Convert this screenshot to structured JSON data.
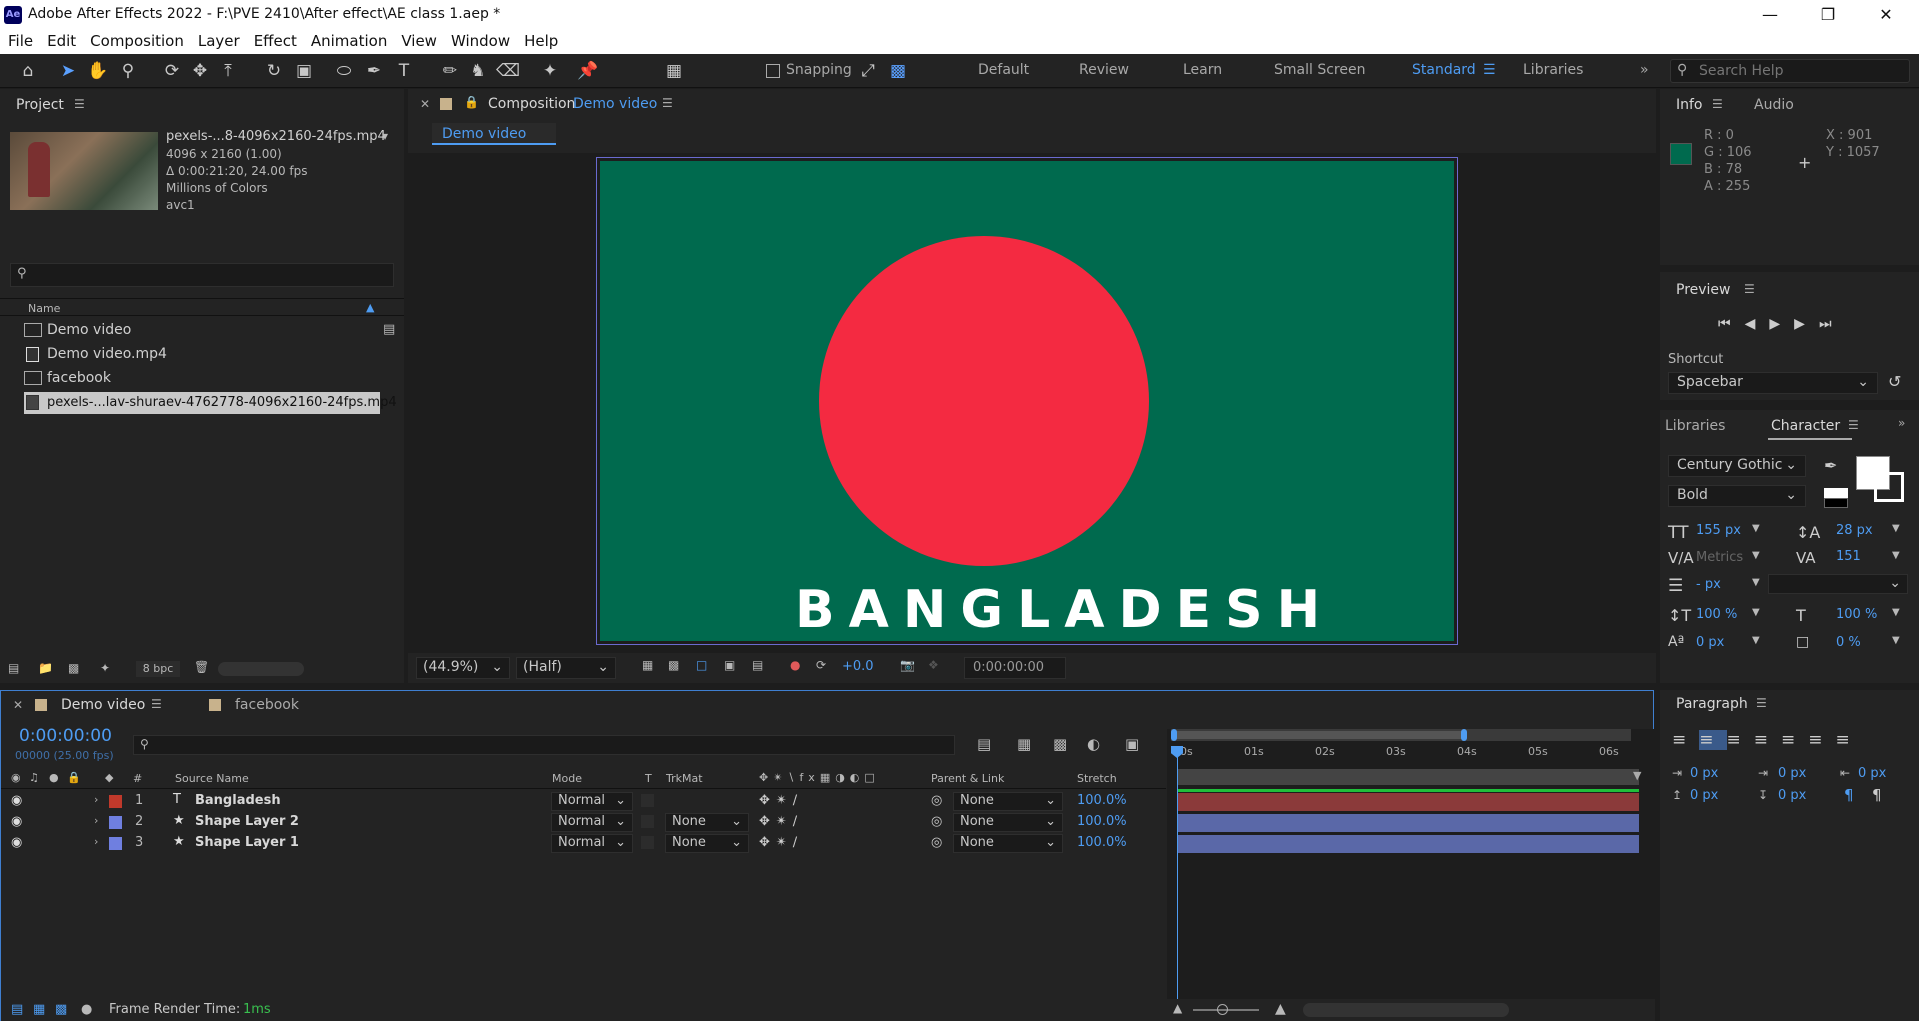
{
  "window": {
    "title": "Adobe After Effects 2022 - F:\\PVE 2410\\After effect\\AE class 1.aep *",
    "app_icon": "Ae"
  },
  "menu": [
    "File",
    "Edit",
    "Composition",
    "Layer",
    "Effect",
    "Animation",
    "View",
    "Window",
    "Help"
  ],
  "toolbar": {
    "snapping_label": "Snapping",
    "workspaces": [
      "Default",
      "Review",
      "Learn",
      "Small Screen",
      "Standard",
      "Libraries"
    ],
    "active_workspace": "Standard",
    "search_placeholder": "Search Help"
  },
  "project": {
    "tab": "Project",
    "footage": {
      "name": "pexels-...8-4096x2160-24fps.mp4",
      "dims": "4096 x 2160 (1.00)",
      "duration": "Δ 0:00:21:20, 24.00 fps",
      "colors": "Millions of Colors",
      "codec": "avc1"
    },
    "column_name": "Name",
    "items": [
      {
        "label": "Demo video",
        "type": "composition"
      },
      {
        "label": "Demo video.mp4",
        "type": "footage"
      },
      {
        "label": "facebook",
        "type": "composition"
      },
      {
        "label": "pexels-...lav-shuraev-4762778-4096x2160-24fps.mp4",
        "type": "footage",
        "selected": true
      }
    ],
    "bpc": "8 bpc"
  },
  "composition": {
    "tab_prefix": "Composition",
    "tab_name": "Demo video",
    "sub_tab": "Demo video",
    "flag_text": "BANGLADESH",
    "flag_green": "#006a4e",
    "flag_red": "#f42a41",
    "zoom": "(44.9%)",
    "resolution": "(Half)",
    "exposure": "+0.0",
    "timecode": "0:00:00:00"
  },
  "info": {
    "tabs": [
      "Info",
      "Audio"
    ],
    "color_swatch": "#006a4e",
    "rgba": [
      "R : 0",
      "G : 106",
      "B : 78",
      "A : 255"
    ],
    "xy": [
      "X : 901",
      "Y : 1057"
    ]
  },
  "preview": {
    "title": "Preview",
    "shortcut_label": "Shortcut",
    "shortcut_value": "Spacebar"
  },
  "character": {
    "tabs": [
      "Libraries",
      "Character"
    ],
    "font": "Century Gothic",
    "style": "Bold",
    "size": "155 px",
    "leading": "28 px",
    "kerning": "Metrics",
    "tracking": "151",
    "stroke": "- px",
    "vscale": "100 %",
    "hscale": "100 %",
    "baseline": "0 px",
    "tsume": "0 %"
  },
  "paragraph": {
    "title": "Paragraph",
    "indents": [
      "0 px",
      "0 px",
      "0 px",
      "0 px",
      "0 px"
    ]
  },
  "timeline": {
    "tabs": [
      "Demo video",
      "facebook"
    ],
    "timecode": "0:00:00:00",
    "frames": "00000 (25.00 fps)",
    "columns": [
      "#",
      "Source Name",
      "Mode",
      "T",
      "TrkMat",
      "Parent & Link",
      "Stretch"
    ],
    "ruler": [
      "00s",
      "01s",
      "02s",
      "03s",
      "04s",
      "05s",
      "06s"
    ],
    "layers": [
      {
        "num": "1",
        "name": "Bangladesh",
        "type": "text",
        "color": "#c0392b",
        "mode": "Normal",
        "trkmat": "",
        "parent": "None",
        "stretch": "100.0%",
        "bar": "#8b3a3a"
      },
      {
        "num": "2",
        "name": "Shape Layer 2",
        "type": "shape",
        "color": "#6f7fe0",
        "mode": "Normal",
        "trkmat": "None",
        "parent": "None",
        "stretch": "100.0%",
        "bar": "#5a68a8"
      },
      {
        "num": "3",
        "name": "Shape Layer 1",
        "type": "shape",
        "color": "#6f7fe0",
        "mode": "Normal",
        "trkmat": "None",
        "parent": "None",
        "stretch": "100.0%",
        "bar": "#5a68a8"
      }
    ],
    "render_label": "Frame Render Time:",
    "render_value": "1ms"
  }
}
